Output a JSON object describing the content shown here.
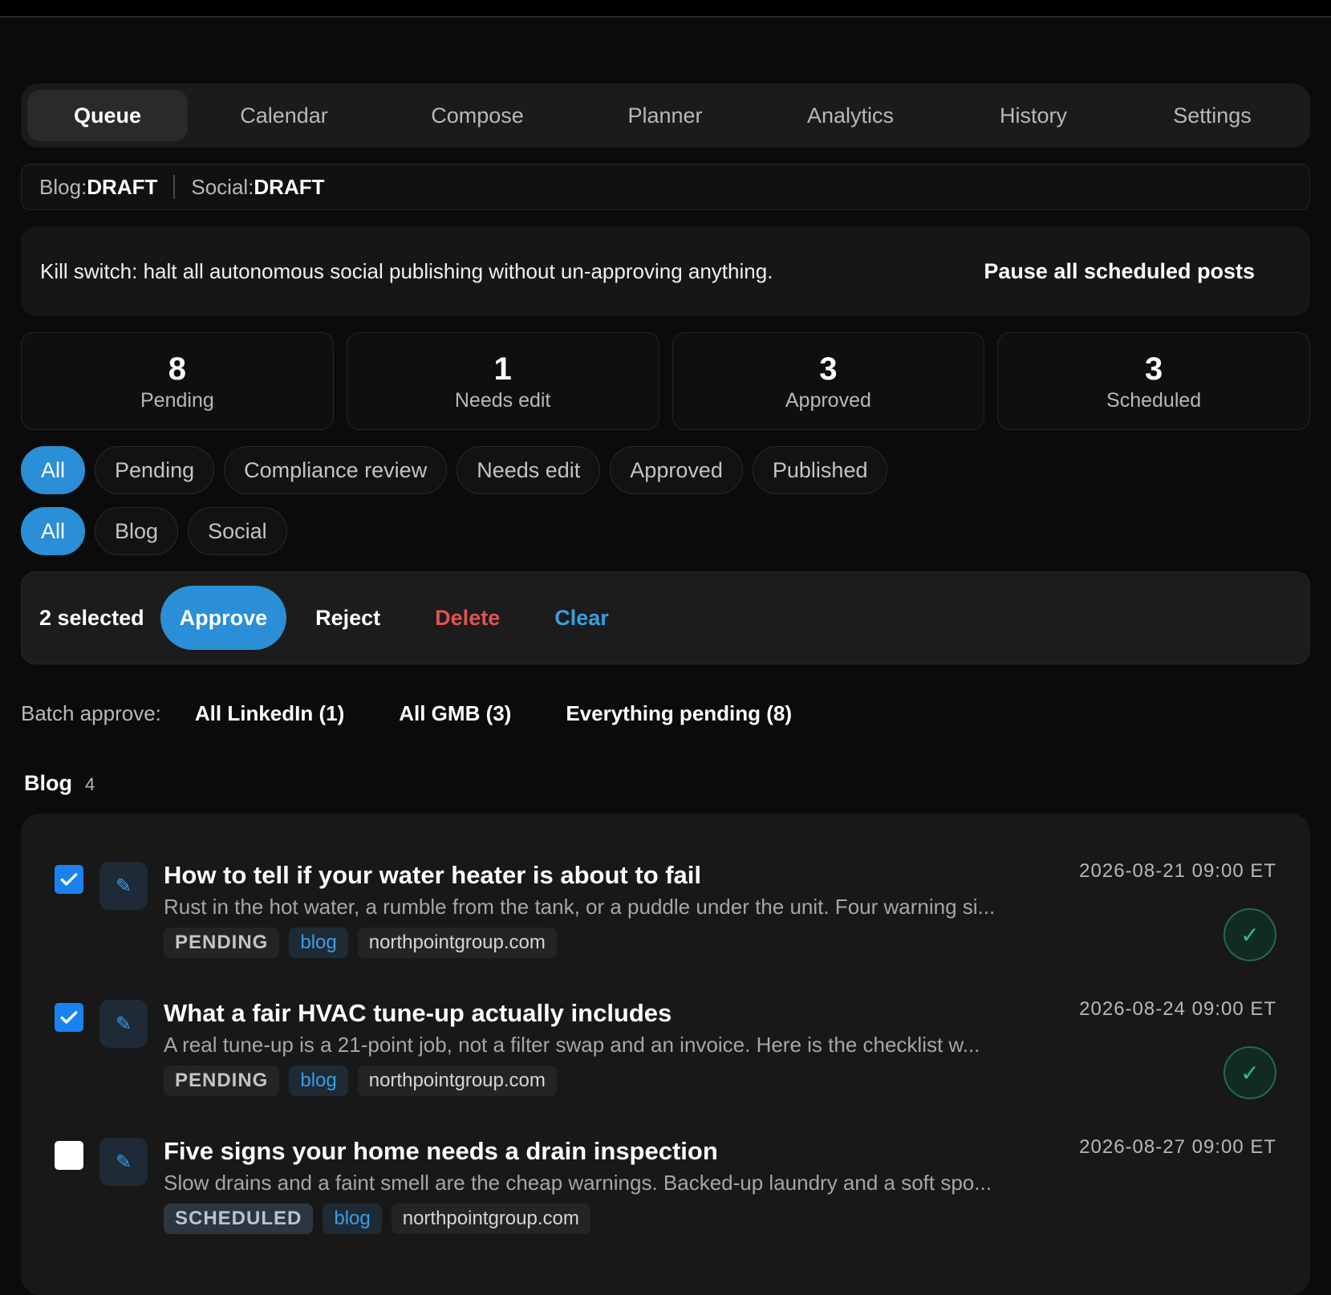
{
  "tabs": [
    {
      "label": "Queue",
      "active": true
    },
    {
      "label": "Calendar"
    },
    {
      "label": "Compose"
    },
    {
      "label": "Planner"
    },
    {
      "label": "Analytics"
    },
    {
      "label": "History"
    },
    {
      "label": "Settings"
    }
  ],
  "status": {
    "blog_label": "Blog: ",
    "blog_value": "DRAFT",
    "social_label": "Social: ",
    "social_value": "DRAFT"
  },
  "kill_switch": {
    "text": "Kill switch: halt all autonomous social publishing without un-approving anything.",
    "button": "Pause all scheduled posts"
  },
  "stats": [
    {
      "value": "8",
      "label": "Pending"
    },
    {
      "value": "1",
      "label": "Needs edit"
    },
    {
      "value": "3",
      "label": "Approved"
    },
    {
      "value": "3",
      "label": "Scheduled"
    }
  ],
  "status_filters": [
    "All",
    "Pending",
    "Compliance review",
    "Needs edit",
    "Approved",
    "Published"
  ],
  "type_filters": [
    "All",
    "Blog",
    "Social"
  ],
  "bulk": {
    "count": "2 selected",
    "approve": "Approve",
    "reject": "Reject",
    "delete": "Delete",
    "clear": "Clear"
  },
  "batch": {
    "label": "Batch approve:",
    "links": [
      "All LinkedIn (1)",
      "All GMB (3)",
      "Everything pending (8)"
    ]
  },
  "section": {
    "title": "Blog",
    "count": "4"
  },
  "items": [
    {
      "checked": true,
      "title": "How to tell if your water heater is about to fail",
      "excerpt": "Rust in the hot water, a rumble from the tank, or a puddle under the unit. Four warning si...",
      "status": "PENDING",
      "type": "blog",
      "site": "northpointgroup.com",
      "date": "2026-08-21 09:00 ET",
      "approve_icon": "check-icon"
    },
    {
      "checked": true,
      "title": "What a fair HVAC tune-up actually includes",
      "excerpt": "A real tune-up is a 21-point job, not a filter swap and an invoice. Here is the checklist w...",
      "status": "PENDING",
      "type": "blog",
      "site": "northpointgroup.com",
      "date": "2026-08-24 09:00 ET",
      "approve_icon": "check-icon"
    },
    {
      "checked": false,
      "title": "Five signs your home needs a drain inspection",
      "excerpt": "Slow drains and a faint smell are the cheap warnings. Backed-up laundry and a soft spo...",
      "status": "SCHEDULED",
      "type": "blog",
      "site": "northpointgroup.com",
      "date": "2026-08-27 09:00 ET"
    }
  ],
  "colors": {
    "accent": "#2a8fd6",
    "danger": "#e05252",
    "success": "#2ec27e"
  }
}
